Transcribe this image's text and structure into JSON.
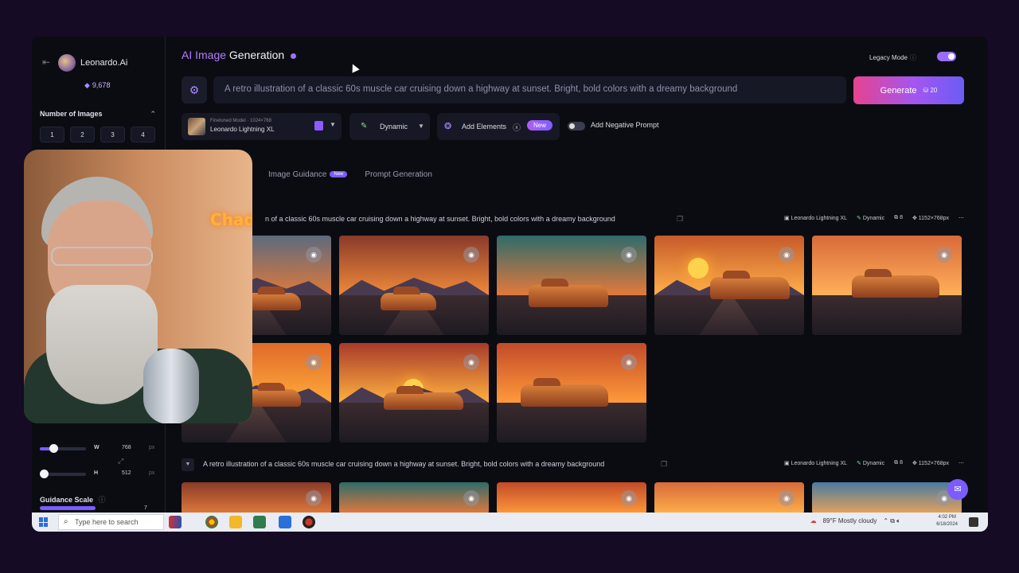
{
  "sidebar": {
    "brand": "Leonardo.Ai",
    "tokens": "9,678",
    "num_images_title": "Number of Images",
    "num_options": [
      "1",
      "2",
      "3",
      "4"
    ],
    "width_label": "W",
    "width_value": "768",
    "width_unit": "px",
    "height_label": "H",
    "height_value": "512",
    "height_unit": "px",
    "guidance_scale_label": "Guidance Scale",
    "guidance_scale_value": "7"
  },
  "header": {
    "title_ai": "AI Image",
    "title_gen": " Generation",
    "legacy_mode": "Legacy Mode",
    "legacy_mode_on": true
  },
  "prompt": {
    "text": "A retro illustration of a classic 60s muscle car cruising down a highway at sunset. Bright, bold colors with a dreamy background",
    "generate_label": "Generate",
    "generate_cost": "20"
  },
  "controls": {
    "model_caption": "Finetuned Model",
    "model_dims": "1024×768",
    "model_name": "Leonardo Lightning XL",
    "style": "Dynamic",
    "add_elements": "Add Elements",
    "new_badge": "New",
    "add_negative_prompt": "Add Negative Prompt"
  },
  "tabs": [
    {
      "label": "Image Guidance",
      "badge": "New"
    },
    {
      "label": "Prompt Generation"
    }
  ],
  "generations": [
    {
      "prompt_visible": "n of a classic 60s muscle car cruising down a highway at sunset. Bright, bold colors with a dreamy background",
      "model": "Leonardo Lightning XL",
      "style": "Dynamic",
      "count": "8",
      "size": "1152×768px"
    },
    {
      "prompt_visible": "A retro illustration of a classic 60s muscle car cruising down a highway at sunset. Bright, bold colors with a dreamy background",
      "model": "Leonardo Lightning XL",
      "style": "Dynamic",
      "count": "8",
      "size": "1152×768px"
    }
  ],
  "webcam": {
    "neon_sign": "Chad K"
  },
  "taskbar": {
    "search_placeholder": "Type here to search",
    "weather": "89°F  Mostly cloudy",
    "time": "4:02 PM",
    "date": "6/18/2024"
  }
}
